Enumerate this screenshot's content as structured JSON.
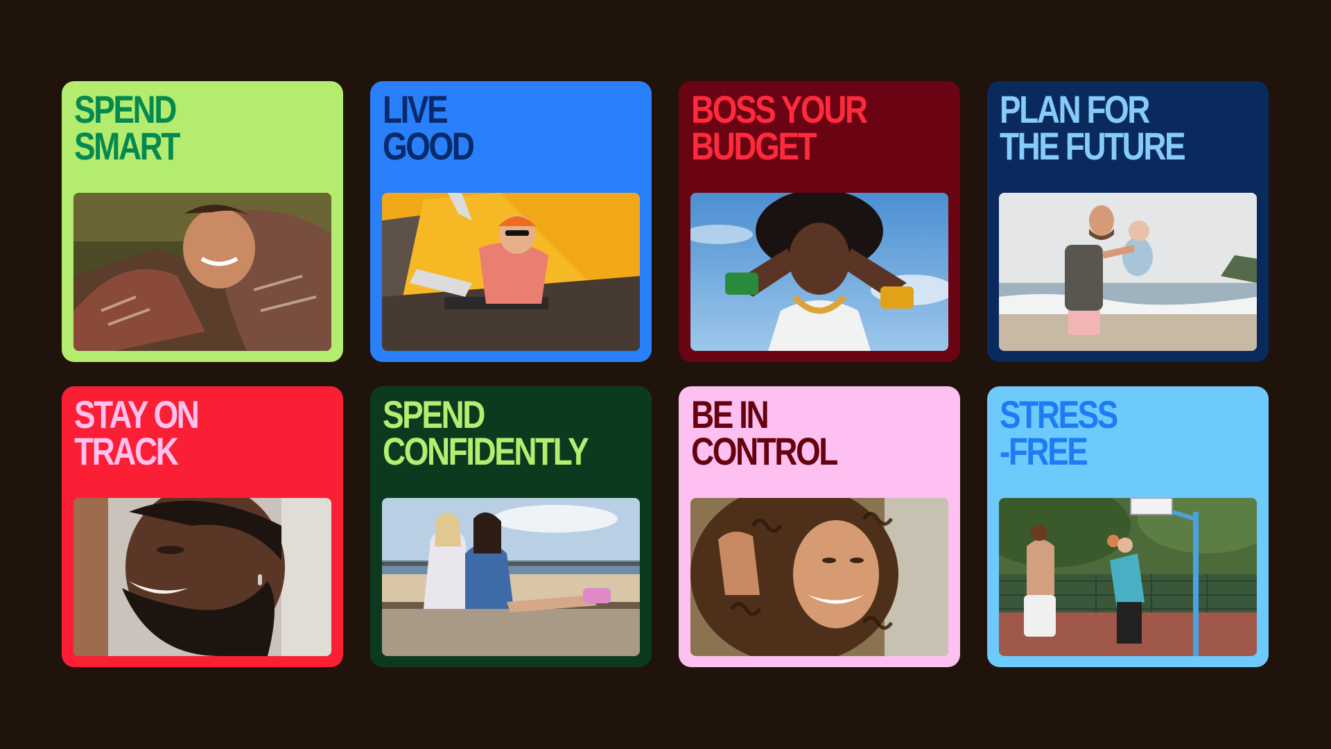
{
  "cards": [
    {
      "line1": "SPEND",
      "line2": "SMART",
      "bg": "#b3ec6e",
      "text": "#05894f",
      "photo": "photo-woman-knit-sweater-lying-on-grass"
    },
    {
      "line1": "LIVE",
      "line2": "GOOD",
      "bg": "#2a7ffb",
      "text": "#062a6b",
      "photo": "photo-woman-camping-in-front-of-yellow-tent"
    },
    {
      "line1": "BOSS YOUR",
      "line2": "BUDGET",
      "bg": "#6a0312",
      "text": "#ff2a3d",
      "photo": "photo-woman-with-bracelets-under-blue-sky"
    },
    {
      "line1": "PLAN FOR",
      "line2": "THE FUTURE",
      "bg": "#0a2a5e",
      "text": "#86ccfb",
      "photo": "photo-father-lifting-baby-on-beach"
    },
    {
      "line1": "STAY ON",
      "line2": "TRACK",
      "bg": "#fb1f35",
      "text": "#ffc1ef",
      "photo": "photo-smiling-bearded-man"
    },
    {
      "line1": "SPEND",
      "line2": "CONFIDENTLY",
      "bg": "#0b3a1f",
      "text": "#b4ee70",
      "photo": "photo-two-women-sitting-on-boardwalk"
    },
    {
      "line1": "BE IN",
      "line2": "CONTROL",
      "bg": "#fdc0f1",
      "text": "#65020e",
      "photo": "photo-smiling-woman-curly-hair"
    },
    {
      "line1": "STRESS",
      "line2": "-FREE",
      "bg": "#6dcafb",
      "text": "#1d7bf6",
      "photo": "photo-basketball-court-friends"
    }
  ]
}
